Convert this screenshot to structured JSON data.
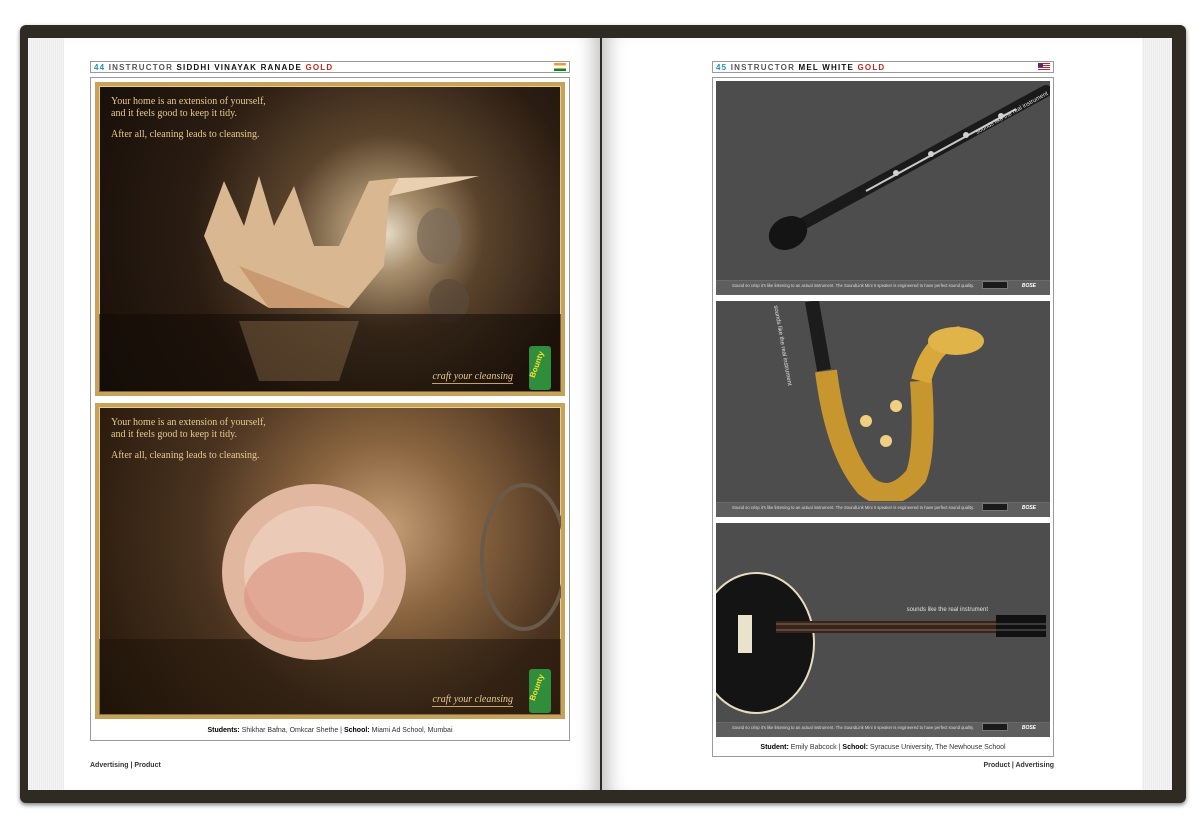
{
  "left_page": {
    "header": {
      "page_number": "44",
      "role": "INSTRUCTOR",
      "instructor": "SIDDHI VINAYAK RANADE",
      "award": "GOLD",
      "flag_icon": "india-flag-icon"
    },
    "ads": [
      {
        "copy_line1": "Your home is an extension of yourself,",
        "copy_line2": "and it feels good to keep it tidy.",
        "copy_line3": "After all, cleaning leads to cleansing.",
        "tagline": "craft your cleansing",
        "brand": "Bounty"
      },
      {
        "copy_line1": "Your home is an extension of yourself,",
        "copy_line2": "and it feels good to keep it tidy.",
        "copy_line3": "After all, cleaning leads to cleansing.",
        "tagline": "craft your cleansing",
        "brand": "Bounty"
      }
    ],
    "credit": {
      "students_label": "Students:",
      "students": "Shikhar Bafna, Omkcar Shethe",
      "separator": "|",
      "school_label": "School:",
      "school": "Miami Ad School, Mumbai"
    },
    "footer": "Advertising | Product"
  },
  "right_page": {
    "header": {
      "page_number": "45",
      "role": "INSTRUCTOR",
      "instructor": "MEL WHITE",
      "award": "GOLD",
      "flag_icon": "usa-flag-icon"
    },
    "ads": [
      {
        "headline": "sounds like the real instrument",
        "body": "Sound so crisp it's like listening to an actual instrument. The SoundLink Mini II speaker is engineered to have perfect sound quality.",
        "brand": "BOSE"
      },
      {
        "headline": "sounds like the real instrument",
        "body": "Sound so crisp it's like listening to an actual instrument. The SoundLink Mini II speaker is engineered to have perfect sound quality.",
        "brand": "BOSE"
      },
      {
        "headline": "sounds like the real instrument",
        "body": "Sound so crisp it's like listening to an actual instrument. The SoundLink Mini II speaker is engineered to have perfect sound quality.",
        "brand": "BOSE"
      }
    ],
    "credit": {
      "student_label": "Student:",
      "student": "Emily Babcock",
      "separator": "|",
      "school_label": "School:",
      "school": "Syracuse University, The Newhouse School"
    },
    "footer": "Product | Advertising"
  },
  "colors": {
    "cover": "#2f2a22",
    "gold_frame": "#c9a25a",
    "page_number_blue": "#1f8fb5",
    "award_red": "#c42a1e",
    "ad_gray": "#4d4d4d"
  }
}
